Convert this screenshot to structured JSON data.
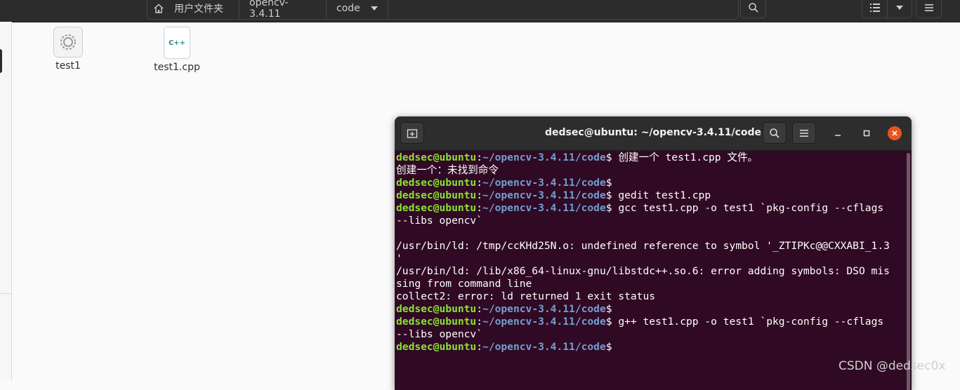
{
  "file_manager": {
    "path": [
      "用户文件夹",
      "opencv-3.4.11",
      "code"
    ],
    "files": [
      {
        "name": "test1",
        "icon": "executable-gear-icon"
      },
      {
        "name": "test1.cpp",
        "icon": "cpp-source-icon",
        "badge": "C++"
      }
    ]
  },
  "terminal": {
    "title": "dedsec@ubuntu: ~/opencv-3.4.11/code",
    "user": "dedsec@ubuntu",
    "sep": ":",
    "path": "~/opencv-3.4.11/code",
    "lines": [
      {
        "type": "prompt",
        "cmd": "$ 创建一个 test1.cpp 文件。"
      },
      {
        "type": "output",
        "text": "创建一个：未找到命令"
      },
      {
        "type": "prompt",
        "cmd": "$"
      },
      {
        "type": "prompt",
        "cmd": "$ gedit test1.cpp"
      },
      {
        "type": "prompt",
        "cmd": "$ gcc test1.cpp -o test1 `pkg-config --cflags"
      },
      {
        "type": "output",
        "text": "--libs opencv`"
      },
      {
        "type": "output",
        "text": ""
      },
      {
        "type": "output",
        "text": "/usr/bin/ld: /tmp/ccKHd25N.o: undefined reference to symbol '_ZTIPKc@@CXXABI_1.3"
      },
      {
        "type": "output",
        "text": "'"
      },
      {
        "type": "output",
        "text": "/usr/bin/ld: /lib/x86_64-linux-gnu/libstdc++.so.6: error adding symbols: DSO mis"
      },
      {
        "type": "output",
        "text": "sing from command line"
      },
      {
        "type": "output",
        "text": "collect2: error: ld returned 1 exit status"
      },
      {
        "type": "prompt",
        "cmd": "$"
      },
      {
        "type": "prompt",
        "cmd": "$ g++ test1.cpp -o test1 `pkg-config --cflags"
      },
      {
        "type": "output",
        "text": "--libs opencv`"
      },
      {
        "type": "prompt",
        "cmd": "$"
      }
    ]
  },
  "watermark": "CSDN @dedsec0x",
  "colors": {
    "terminal_bg": "#300a24",
    "prompt_user": "#8ae234",
    "prompt_path": "#729fcf",
    "close_button": "#e95420"
  }
}
